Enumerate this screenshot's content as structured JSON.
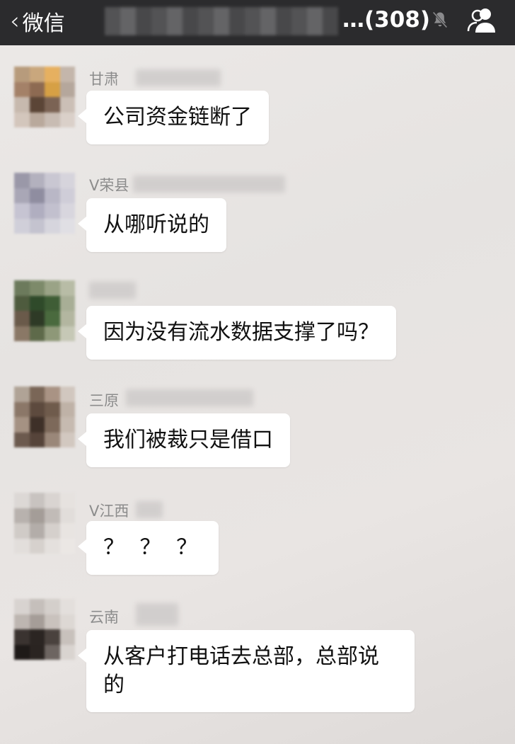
{
  "header": {
    "back_label": "微信",
    "member_count": "…(308)"
  },
  "messages": [
    {
      "sender": "甘肃",
      "text": "公司资金链断了"
    },
    {
      "sender": "V荣县",
      "text": "从哪听说的"
    },
    {
      "sender": "",
      "text": "因为没有流水数据支撑了吗？"
    },
    {
      "sender": "三原",
      "text": "我们被裁只是借口"
    },
    {
      "sender": "V江西",
      "text": "？ ？ ？"
    },
    {
      "sender": "云南",
      "text": "从客户打电话去总部，总部说的"
    }
  ],
  "icons": {
    "back": "chevron-left-icon",
    "mute": "mute-bell-icon",
    "members": "group-members-icon"
  }
}
